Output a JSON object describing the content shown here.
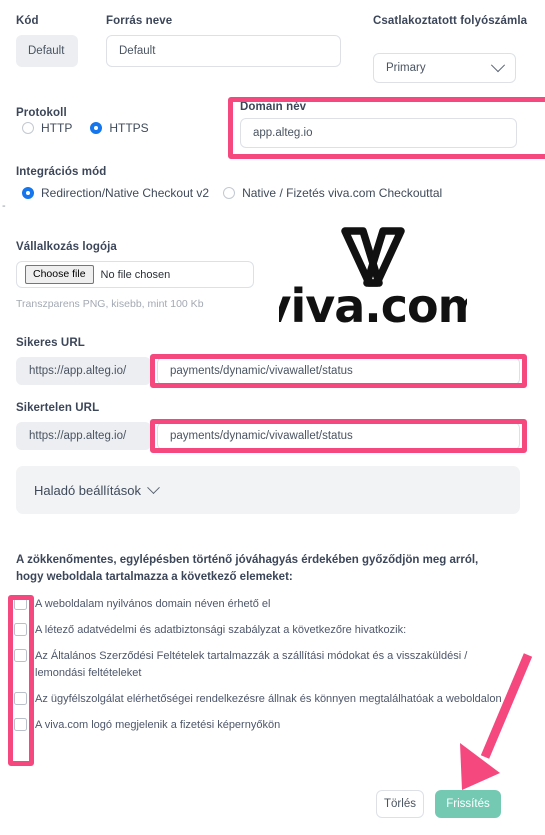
{
  "form": {
    "code": {
      "label": "Kód",
      "value": "Default"
    },
    "source_name": {
      "label": "Forrás neve",
      "value": "Default"
    },
    "connected_account": {
      "label": "Csatlakoztatott folyószámla",
      "value": "Primary",
      "options": [
        "Primary"
      ]
    },
    "protocol": {
      "label": "Protokoll",
      "options": [
        {
          "label": "HTTP",
          "selected": false
        },
        {
          "label": "HTTPS",
          "selected": true
        }
      ]
    },
    "domain": {
      "label": "Domain név",
      "value": "app.alteg.io"
    },
    "integration_mode": {
      "label": "Integrációs mód",
      "options": [
        {
          "label": "Redirection/Native Checkout v2",
          "selected": true
        },
        {
          "label": "Native / Fizetés viva.com Checkouttal",
          "selected": false
        }
      ]
    },
    "dash_marker": "-",
    "company_logo": {
      "label": "Vállalkozás logója",
      "choose_button": "Choose file",
      "file_status": "No file chosen",
      "hint": "Transzparens PNG, kisebb, mint 100 Kb"
    },
    "success_url": {
      "label": "Sikeres URL",
      "prefix": "https://app.alteg.io/",
      "value": "payments/dynamic/vivawallet/status"
    },
    "failure_url": {
      "label": "Sikertelen URL",
      "prefix": "https://app.alteg.io/",
      "value": "payments/dynamic/vivawallet/status"
    },
    "advanced_settings": {
      "label": "Haladó beállítások"
    }
  },
  "brand": {
    "logo_text": "viva.com"
  },
  "checklist": {
    "title": "A zökkenőmentes, egylépésben történő jóváhagyás érdekében győződjön meg arról, hogy weboldala tartalmazza a következő elemeket:",
    "items": [
      {
        "label": "A weboldalam nyilvános domain néven érhető el",
        "checked": false
      },
      {
        "label": "A létező adatvédelmi és adatbiztonsági szabályzat a következőre hivatkozik:",
        "checked": false
      },
      {
        "label": "Az Általános Szerződési Feltételek tartalmazzák a szállítási módokat és a visszaküldési / lemondási feltételeket",
        "checked": false
      },
      {
        "label": "Az ügyfélszolgálat elérhetőségei rendelkezésre állnak és könnyen megtalálhatóak a weboldalon",
        "checked": false
      },
      {
        "label": "A viva.com logó megjelenik a fizetési képernyőkön",
        "checked": false
      }
    ]
  },
  "actions": {
    "delete_label": "Törlés",
    "update_label": "Frissítés"
  },
  "colors": {
    "highlight_pink": "#f4487f",
    "radio_blue": "#1576ed",
    "update_green": "#74c9b2",
    "panel_grey": "#f2f3f5"
  }
}
